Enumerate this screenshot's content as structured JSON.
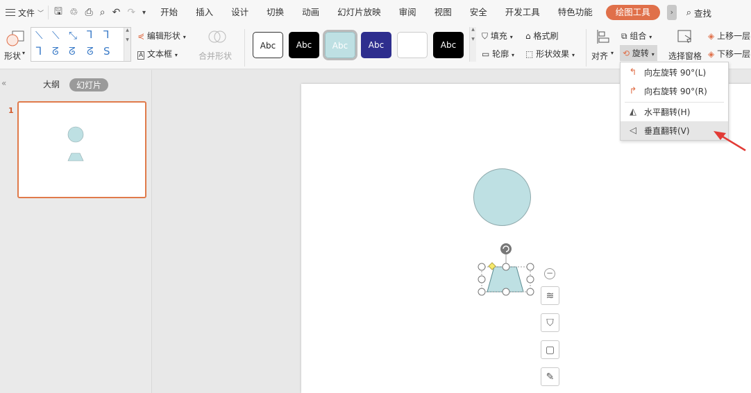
{
  "menubar": {
    "file_label": "文件",
    "tabs": [
      "开始",
      "插入",
      "设计",
      "切换",
      "动画",
      "幻灯片放映",
      "审阅",
      "视图",
      "安全",
      "开发工具",
      "特色功能"
    ],
    "active_tab": "绘图工具",
    "search_label": "查找"
  },
  "ribbon": {
    "shape_label": "形状",
    "edit_shape": "编辑形状",
    "text_box": "文本框",
    "merge_shape": "合并形状",
    "style_sample": "Abc",
    "fill": "填充",
    "format_brush": "格式刷",
    "outline": "轮廓",
    "shape_effect": "形状效果",
    "align": "对齐",
    "group": "组合",
    "rotate": "旋转",
    "selection_pane": "选择窗格",
    "bring_forward": "上移一层",
    "send_backward": "下移一层"
  },
  "left_panel": {
    "outline_tab": "大纲",
    "slides_tab": "幻灯片",
    "slide_number": "1"
  },
  "rotate_menu": {
    "items": [
      {
        "label": "向左旋转 90°(L)"
      },
      {
        "label": "向右旋转 90°(R)"
      },
      {
        "label": "水平翻转(H)"
      },
      {
        "label": "垂直翻转(V)"
      }
    ],
    "highlighted_index": 3
  },
  "colors": {
    "accent": "#e0704a",
    "shape_fill": "#bee0e3",
    "arrow": "#e23b36"
  }
}
